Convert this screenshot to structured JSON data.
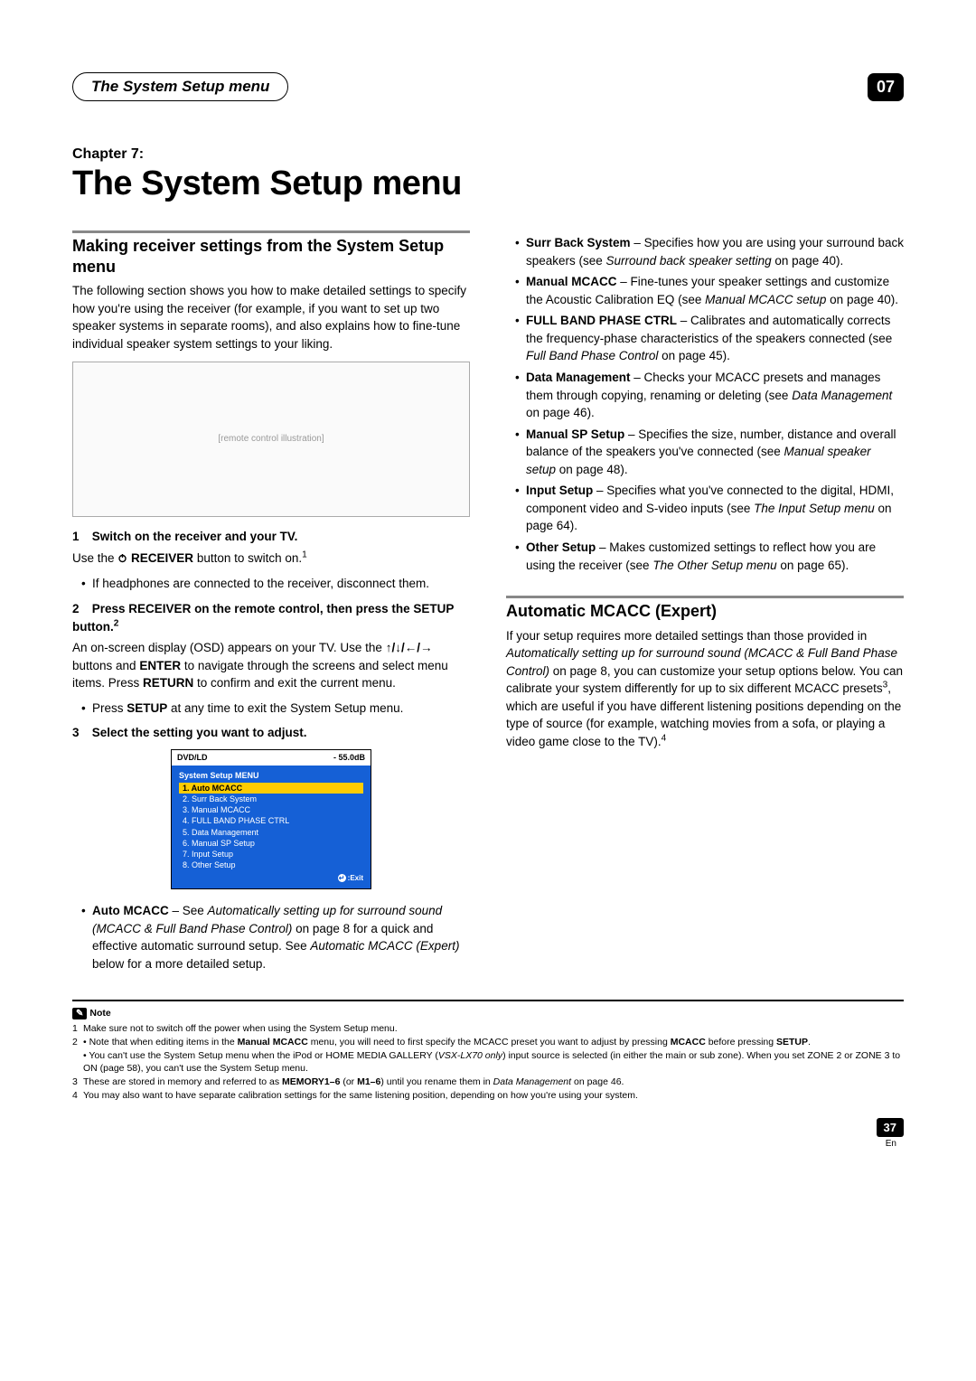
{
  "header": {
    "pill": "The System Setup menu",
    "chapter_num": "07"
  },
  "chapter": {
    "label": "Chapter 7:",
    "title": "The System Setup menu"
  },
  "left": {
    "sec1_heading": "Making receiver settings from the System Setup menu",
    "sec1_p1": "The following section shows you how to make detailed settings to specify how you're using the receiver (for example, if you want to set up two speaker systems in separate rooms), and also explains how to fine-tune individual speaker system settings to your liking.",
    "figure_alt": "[remote control illustration]",
    "step1_title": "Switch on the receiver and your TV.",
    "step1_body_a": "Use the ",
    "step1_body_b": " RECEIVER",
    "step1_body_c": " button to switch on.",
    "step1_sup": "1",
    "step1_bullet": "If headphones are connected to the receiver, disconnect them.",
    "step2_title_a": "Press RECEIVER on the remote control, then press the SETUP button.",
    "step2_sup": "2",
    "step2_body_a": "An on-screen display (OSD) appears on your TV. Use the ",
    "step2_arrows": "↑/↓/←/→",
    "step2_body_b": " buttons and ",
    "step2_enter": "ENTER",
    "step2_body_c": " to navigate through the screens and select menu items. Press ",
    "step2_return": "RETURN",
    "step2_body_d": " to confirm and exit the current menu.",
    "step2_bullet_a": "Press ",
    "step2_bullet_setup": "SETUP",
    "step2_bullet_b": " at any time to exit the System Setup menu.",
    "step3_title": "Select the setting you want to adjust.",
    "osd": {
      "source": "DVD/LD",
      "level": "- 55.0dB",
      "menu_title": "System Setup MENU",
      "items": [
        "1. Auto MCACC",
        "2. Surr Back System",
        "3. Manual MCACC",
        "4. FULL BAND PHASE CTRL",
        "5. Data Management",
        "6. Manual SP Setup",
        "7. Input Setup",
        "8. Other Setup"
      ],
      "exit": ":Exit"
    },
    "auto_mcacc_label": "Auto MCACC",
    "auto_mcacc_a": " – See ",
    "auto_mcacc_em": "Automatically setting up for surround sound (MCACC & Full Band Phase Control)",
    "auto_mcacc_b": " on page 8 for a quick and effective automatic surround setup. See ",
    "auto_mcacc_em2": "Automatic MCACC (Expert)",
    "auto_mcacc_c": " below for a more detailed setup."
  },
  "right": {
    "items": [
      {
        "label": "Surr Back System",
        "a": " – Specifies how you are using your surround back speakers (see ",
        "em": "Surround back speaker setting",
        "b": " on page 40)."
      },
      {
        "label": "Manual MCACC",
        "a": " – Fine-tunes your speaker settings and customize the Acoustic Calibration EQ (see ",
        "em": "Manual MCACC setup",
        "b": " on page 40)."
      },
      {
        "label": "FULL BAND PHASE CTRL",
        "a": " – Calibrates and automatically corrects the frequency-phase characteristics of the speakers connected (see ",
        "em": "Full Band Phase Control",
        "b": " on page 45)."
      },
      {
        "label": "Data Management",
        "a": " – Checks your MCACC presets and manages them through copying, renaming or deleting (see ",
        "em": "Data Management",
        "b": " on page 46)."
      },
      {
        "label": "Manual SP Setup",
        "a": " – Specifies the size, number, distance and overall balance of the speakers you've connected (see ",
        "em": "Manual speaker setup",
        "b": " on page 48)."
      },
      {
        "label": "Input Setup",
        "a": " – Specifies what you've connected to the digital, HDMI, component video and S-video inputs (see ",
        "em": "The Input Setup menu",
        "b": " on page 64)."
      },
      {
        "label": "Other Setup",
        "a": " – Makes customized settings to reflect how you are using the receiver (see ",
        "em": "The Other Setup menu",
        "b": " on page 65)."
      }
    ],
    "sec2_heading": "Automatic MCACC (Expert)",
    "sec2_p_a": "If your setup requires more detailed settings than those provided in ",
    "sec2_em": "Automatically setting up for surround sound (MCACC & Full Band Phase Control)",
    "sec2_p_b": " on page 8, you can customize your setup options below. You can calibrate your system differently for up to six different MCACC presets",
    "sec2_sup1": "3",
    "sec2_p_c": ", which are useful if you have different listening positions depending on the type of source (for example, watching movies from a sofa, or playing a video game close to the TV).",
    "sec2_sup2": "4"
  },
  "notes": {
    "label": "Note",
    "fn1": "Make sure not to switch off the power when using the System Setup menu.",
    "fn2a_pre": "• Note that when editing items in the ",
    "fn2a_b1": "Manual MCACC",
    "fn2a_mid": " menu, you will need to first specify the MCACC preset you want to adjust by pressing ",
    "fn2a_b2": "MCACC",
    "fn2a_post": " before pressing ",
    "fn2a_b3": "SETUP",
    "fn2a_end": ".",
    "fn2b_a": "• You can't use the System Setup menu when the iPod or HOME MEDIA GALLERY (",
    "fn2b_em": "VSX-LX70 only",
    "fn2b_b": ") input source is selected (in either the main or sub zone). When you set ZONE 2 or ZONE 3 to ON (page 58), you can't use the System Setup menu.",
    "fn3_a": "These are stored in memory and referred to as ",
    "fn3_b1": "MEMORY1–6",
    "fn3_mid": " (or ",
    "fn3_b2": "M1–6",
    "fn3_b": ") until you rename them in ",
    "fn3_em": "Data Management",
    "fn3_c": " on page 46.",
    "fn4": "You may also want to have separate calibration settings for the same listening position, depending on how you're using your system."
  },
  "footer": {
    "page_num": "37",
    "lang": "En"
  }
}
